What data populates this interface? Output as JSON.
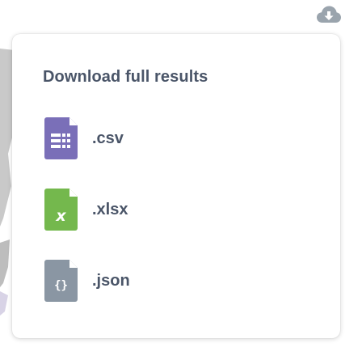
{
  "download_trigger": {
    "icon": "cloud-download-icon",
    "color": "#9aa4ad"
  },
  "popover": {
    "title": "Download full results",
    "options": [
      {
        "label": ".csv",
        "icon": "csv-file-icon",
        "color": "#7a6fb8"
      },
      {
        "label": ".xlsx",
        "icon": "xlsx-file-icon",
        "color": "#74b84d"
      },
      {
        "label": ".json",
        "icon": "json-file-icon",
        "color": "#8a96a3"
      }
    ]
  }
}
